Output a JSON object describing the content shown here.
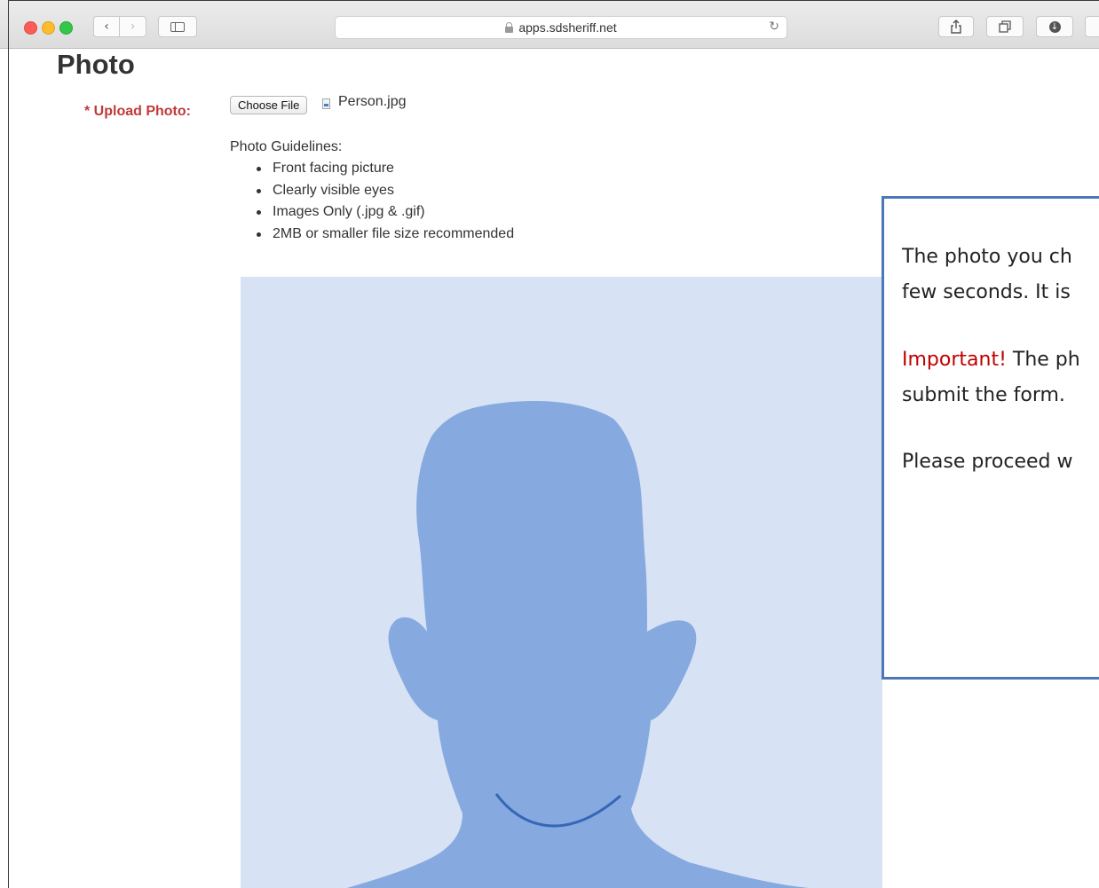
{
  "browser": {
    "url": "apps.sdsheriff.net",
    "nav_back_icon": "chevron-left-icon",
    "nav_forward_icon": "chevron-right-icon",
    "reload_icon": "reload-icon"
  },
  "page": {
    "title": "Photo",
    "upload_label": "* Upload Photo:",
    "choose_file_label": "Choose File",
    "selected_file": "Person.jpg",
    "guidelines_heading": "Photo Guidelines:",
    "guidelines": [
      "Front facing picture",
      "Clearly visible eyes",
      "Images Only (.jpg & .gif)",
      "2MB or smaller file size recommended"
    ]
  },
  "callout": {
    "line1": "The photo you ch",
    "line2": "few seconds. It is",
    "important_label": "Important!",
    "line3": " The ph",
    "line4": "submit the form.",
    "line5": "Please proceed w"
  },
  "colors": {
    "accent_red": "#c0393b",
    "callout_border": "#4d78b8",
    "silhouette": "#86a9df",
    "photo_bg": "#d7e2f4"
  }
}
